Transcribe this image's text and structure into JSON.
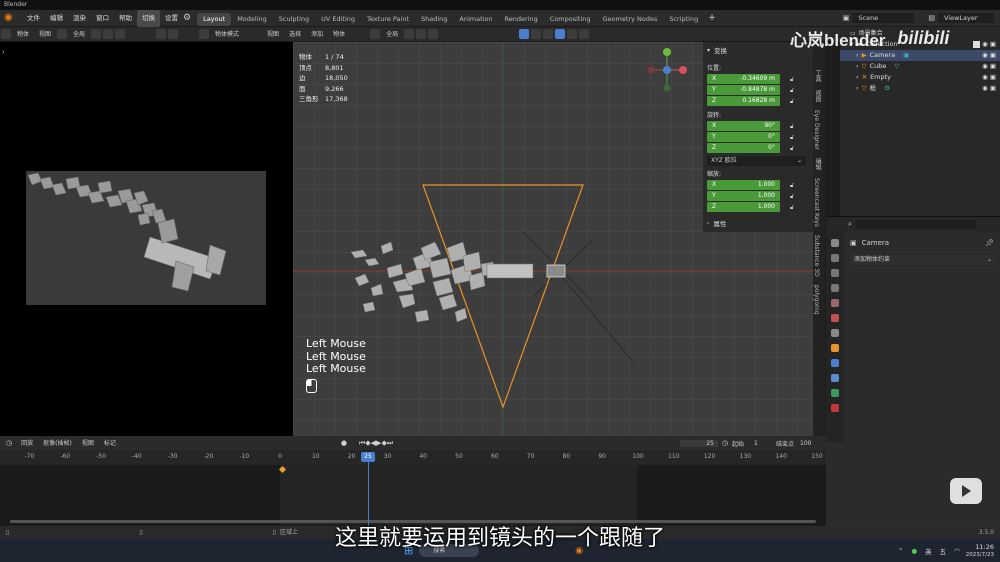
{
  "window": {
    "title": "Blender"
  },
  "menu": {
    "items": [
      "文件",
      "编辑",
      "渲染",
      "窗口",
      "帮助"
    ],
    "active_tool": "切换",
    "settings": "设置"
  },
  "workspaces": [
    "Layout",
    "Modeling",
    "Sculpting",
    "UV Editing",
    "Texture Paint",
    "Shading",
    "Animation",
    "Rendering",
    "Compositing",
    "Geometry Nodes",
    "Scripting"
  ],
  "active_workspace": "Layout",
  "scene": {
    "scene_name": "Scene",
    "view_layer": "ViewLayer"
  },
  "header_left": {
    "items": [
      "物体",
      "视图",
      "全局"
    ]
  },
  "header_right": {
    "mode": "物体模式",
    "items": [
      "视图",
      "选择",
      "添加",
      "物体"
    ],
    "orientation": "全局"
  },
  "stats": [
    {
      "label": "物体",
      "value": "1 / 74"
    },
    {
      "label": "顶点",
      "value": "8,801"
    },
    {
      "label": "边",
      "value": "18,050"
    },
    {
      "label": "面",
      "value": "9,266"
    },
    {
      "label": "三角形",
      "value": "17,368"
    }
  ],
  "key_overlay": [
    "Left Mouse",
    "Left Mouse",
    "Left Mouse"
  ],
  "transform": {
    "title": "变换",
    "location_label": "位置:",
    "location": [
      {
        "axis": "X",
        "value": "-0.34609 m"
      },
      {
        "axis": "Y",
        "value": "-0.84878 m"
      },
      {
        "axis": "Z",
        "value": "0.16828 m"
      }
    ],
    "rotation_label": "旋转:",
    "rotation": [
      {
        "axis": "X",
        "value": "90°"
      },
      {
        "axis": "Y",
        "value": "0°"
      },
      {
        "axis": "Z",
        "value": "0°"
      }
    ],
    "rotation_mode": "XYZ 欧拉",
    "scale_label": "缩放:",
    "scale": [
      {
        "axis": "X",
        "value": "1.000"
      },
      {
        "axis": "Y",
        "value": "1.000"
      },
      {
        "axis": "Z",
        "value": "1.000"
      }
    ],
    "properties_label": "属性"
  },
  "side_tabs": [
    "工具",
    "视图",
    "Eye Designer",
    "编辑",
    "Screencast Keys",
    "Substance 3D",
    "polygoniq"
  ],
  "outliner": {
    "root": "场景集合",
    "collection": "Collection",
    "items": [
      "Camera",
      "Cube",
      "Empty",
      "枪"
    ]
  },
  "properties": {
    "object_name": "Camera",
    "add_constraint": "添加物体约束"
  },
  "timeline": {
    "menus": [
      "回放",
      "抠像(插帧)",
      "视图",
      "标记"
    ],
    "current_frame": "25",
    "start_label": "起始",
    "start": "1",
    "end_label": "结束点",
    "end": "100",
    "ticks": [
      -70,
      -60,
      -50,
      -40,
      -30,
      -20,
      -10,
      0,
      10,
      20,
      25,
      30,
      40,
      50,
      60,
      70,
      80,
      90,
      100,
      110,
      120,
      130,
      140,
      150
    ]
  },
  "status": {
    "hint": "区域上",
    "version": "3.5.0"
  },
  "taskbar": {
    "search": "搜索",
    "ime1": "英",
    "ime2": "五",
    "time": "11:26",
    "date": "2023/7/23"
  },
  "subtitle": "这里就要运用到镜头的一个跟随了",
  "watermark": {
    "channel": "心岚blender",
    "logo": "bilibili"
  },
  "colors": {
    "accent_green": "#4a9a3a",
    "active_orange": "#e8922a",
    "playhead": "#4a7fd0"
  }
}
